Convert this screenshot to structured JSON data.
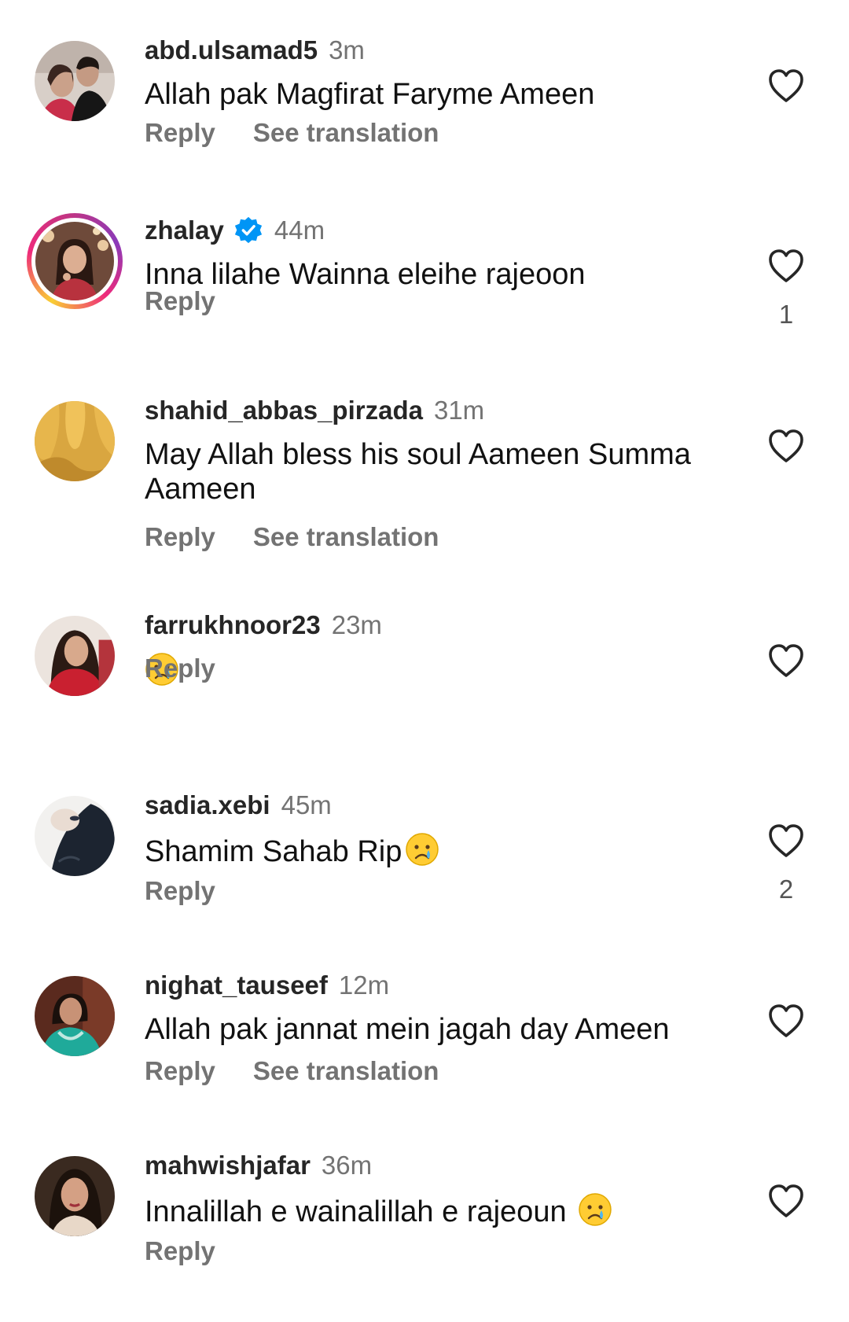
{
  "labels": {
    "reply": "Reply",
    "see_translation": "See translation"
  },
  "colors": {
    "secondary_text": "#737373",
    "verified": "#0095f6",
    "heart_stroke": "#262626"
  },
  "comments": [
    {
      "username": "abd.ulsamad5",
      "time": "3m",
      "text": "Allah pak Magfirat Faryme Ameen",
      "see_translation": true,
      "likes": "",
      "verified": false,
      "story_ring": false,
      "emoji": ""
    },
    {
      "username": "zhalay",
      "time": "44m",
      "text": "Inna lilahe Wainna eleihe rajeoon",
      "see_translation": false,
      "likes": "1",
      "verified": true,
      "story_ring": true,
      "emoji": ""
    },
    {
      "username": "shahid_abbas_pirzada",
      "time": "31m",
      "text": "May Allah bless his soul Aameen Summa Aameen",
      "see_translation": true,
      "likes": "",
      "verified": false,
      "story_ring": false,
      "emoji": ""
    },
    {
      "username": "farrukhnoor23",
      "time": "23m",
      "text": "",
      "see_translation": false,
      "likes": "",
      "verified": false,
      "story_ring": false,
      "emoji": "crying-face"
    },
    {
      "username": "sadia.xebi",
      "time": "45m",
      "text": "Shamim Sahab Rip",
      "see_translation": false,
      "likes": "2",
      "verified": false,
      "story_ring": false,
      "emoji": "crying-face"
    },
    {
      "username": "nighat_tauseef",
      "time": "12m",
      "text": "Allah pak jannat mein jagah day Ameen",
      "see_translation": true,
      "likes": "",
      "verified": false,
      "story_ring": false,
      "emoji": ""
    },
    {
      "username": "mahwishjafar",
      "time": "36m",
      "text": "Innalillah e wainalillah e rajeoun ",
      "see_translation": false,
      "likes": "",
      "verified": false,
      "story_ring": false,
      "emoji": "crying-face"
    }
  ]
}
